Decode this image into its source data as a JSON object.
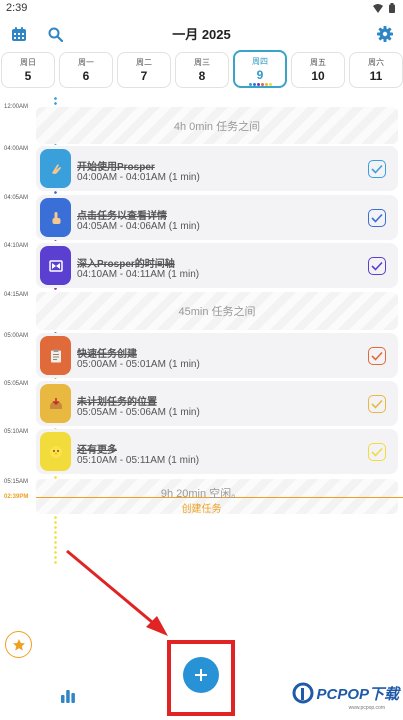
{
  "status_bar": {
    "time": "2:39"
  },
  "header": {
    "title": "一月 2025"
  },
  "week": [
    {
      "name": "周日",
      "date": "5"
    },
    {
      "name": "周一",
      "date": "6"
    },
    {
      "name": "周二",
      "date": "7"
    },
    {
      "name": "周三",
      "date": "8"
    },
    {
      "name": "周四",
      "date": "9",
      "active": true
    },
    {
      "name": "周五",
      "date": "10"
    },
    {
      "name": "周六",
      "date": "11"
    }
  ],
  "timeline": {
    "labels": [
      "12:00AM",
      "04:00AM",
      "04:05AM",
      "04:10AM",
      "04:15AM",
      "05:00AM",
      "05:05AM",
      "05:10AM",
      "05:15AM"
    ],
    "now_label": "02:39PM",
    "gap1": "4h 0min 任务之间",
    "gap2": "45min 任务之间",
    "gap3": "9h 20min 空闲。",
    "create_link": "创建任务"
  },
  "tasks": [
    {
      "title": "开始使用Prosper",
      "time": "04:00AM - 04:01AM (1 min)",
      "icon": "wave-hand-icon",
      "color": "#3aa0dc"
    },
    {
      "title": "点击任务以查看详情",
      "time": "04:05AM - 04:06AM (1 min)",
      "icon": "pointing-finger-icon",
      "color": "#3b6fd8"
    },
    {
      "title": "深入Prosper的时间轴",
      "time": "04:10AM - 04:11AM (1 min)",
      "icon": "hourglass-icon",
      "color": "#5b3fd0"
    },
    {
      "title": "快速任务创建",
      "time": "05:00AM - 05:01AM (1 min)",
      "icon": "clipboard-icon",
      "color": "#e06a3a"
    },
    {
      "title": "未计划任务的位置",
      "time": "05:05AM - 05:06AM (1 min)",
      "icon": "inbox-tray-icon",
      "color": "#e8b840"
    },
    {
      "title": "还有更多",
      "time": "05:10AM - 05:11AM (1 min)",
      "icon": "chick-icon",
      "color": "#f2dc3c"
    }
  ],
  "watermark": {
    "brand": "PCPOP下载",
    "url": "www.pcpop.com"
  }
}
